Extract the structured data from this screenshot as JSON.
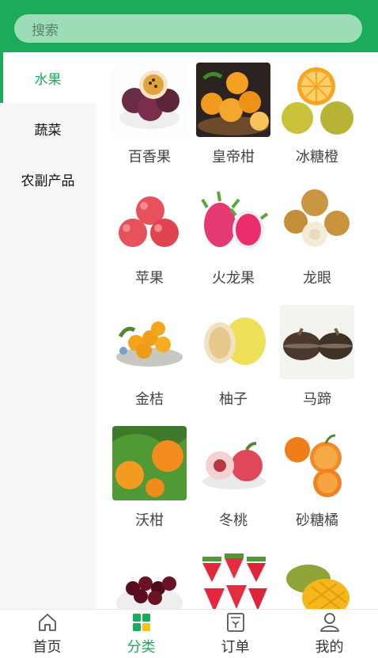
{
  "search": {
    "placeholder": "搜索"
  },
  "sidebar": {
    "items": [
      {
        "label": "水果",
        "active": true
      },
      {
        "label": "蔬菜",
        "active": false
      },
      {
        "label": "农副产品",
        "active": false
      }
    ]
  },
  "products": [
    {
      "name": "百香果"
    },
    {
      "name": "皇帝柑"
    },
    {
      "name": "冰糖橙"
    },
    {
      "name": "苹果"
    },
    {
      "name": "火龙果"
    },
    {
      "name": "龙眼"
    },
    {
      "name": "金桔"
    },
    {
      "name": "柚子"
    },
    {
      "name": "马蹄"
    },
    {
      "name": "沃柑"
    },
    {
      "name": "冬桃"
    },
    {
      "name": "砂糖橘"
    }
  ],
  "tabbar": {
    "items": [
      {
        "label": "首页",
        "icon": "home-icon"
      },
      {
        "label": "分类",
        "icon": "category-icon"
      },
      {
        "label": "订单",
        "icon": "order-icon"
      },
      {
        "label": "我的",
        "icon": "user-icon"
      }
    ]
  },
  "colors": {
    "accent": "#1aac5b",
    "search_bg": "#9cdcb6"
  }
}
